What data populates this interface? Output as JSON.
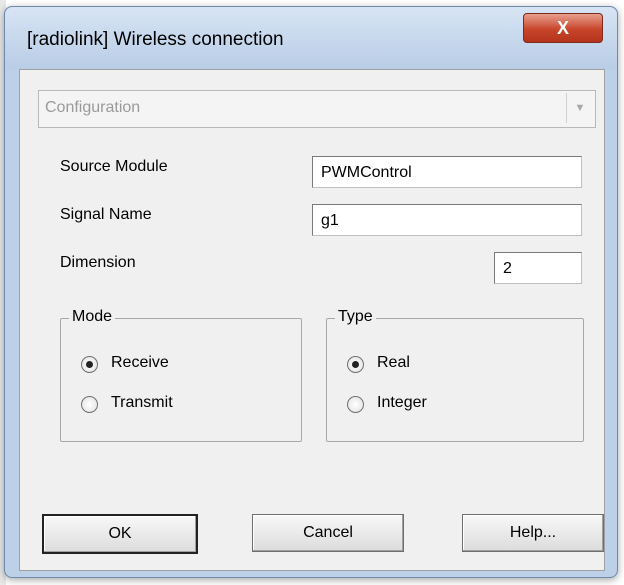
{
  "window": {
    "title": "[radiolink] Wireless connection",
    "close_glyph": "X"
  },
  "config_select": {
    "value": "Configuration"
  },
  "fields": {
    "source_module": {
      "label": "Source Module",
      "value": "PWMControl"
    },
    "signal_name": {
      "label": "Signal Name",
      "value": "g1"
    },
    "dimension": {
      "label": "Dimension",
      "value": "2"
    }
  },
  "mode": {
    "legend": "Mode",
    "options": [
      "Receive",
      "Transmit"
    ],
    "selected": "Receive"
  },
  "type": {
    "legend": "Type",
    "options": [
      "Real",
      "Integer"
    ],
    "selected": "Real"
  },
  "buttons": {
    "ok": "OK",
    "cancel": "Cancel",
    "help": "Help..."
  }
}
